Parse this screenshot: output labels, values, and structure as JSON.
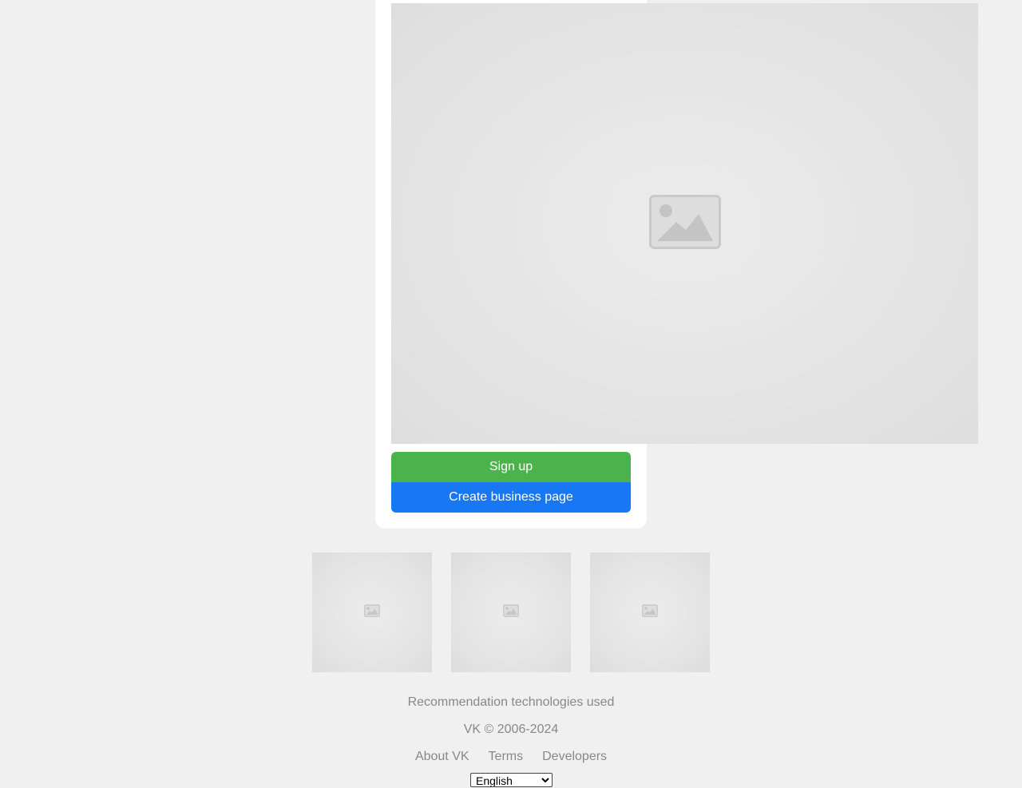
{
  "buttons": {
    "signup_label": "Sign up",
    "business_label": "Create business page"
  },
  "images": {
    "hero_icon": "image-placeholder-icon",
    "thumb_icon": "image-placeholder-icon"
  },
  "footer": {
    "recommendation_text": "Recommendation technologies used",
    "copyright": "VK © 2006-2024",
    "links": [
      "About VK",
      "Terms",
      "Developers"
    ]
  },
  "language": {
    "selected": "English"
  },
  "colors": {
    "page_background": "#f0f0f0",
    "signup_button": "#4bb34b",
    "business_button": "#1877f2",
    "footer_text": "#888888"
  }
}
